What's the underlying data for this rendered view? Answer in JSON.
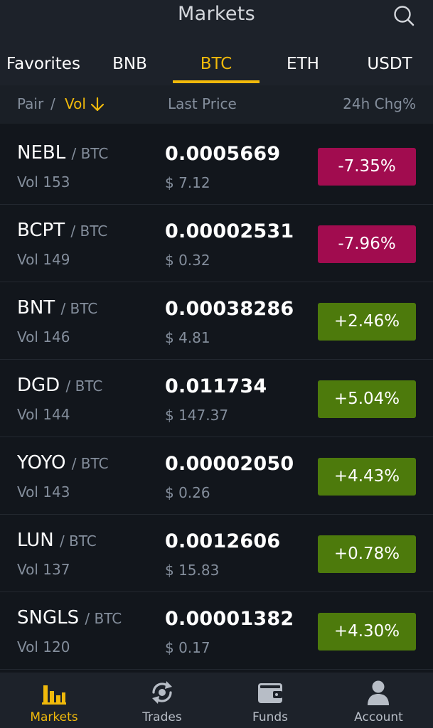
{
  "header": {
    "title": "Markets",
    "search_icon": "search-icon"
  },
  "tabs": [
    {
      "label": "Favorites",
      "active": false
    },
    {
      "label": "BNB",
      "active": false
    },
    {
      "label": "BTC",
      "active": true
    },
    {
      "label": "ETH",
      "active": false
    },
    {
      "label": "USDT",
      "active": false
    }
  ],
  "columns": {
    "pair": "Pair",
    "separator": "/",
    "vol": "Vol",
    "sort_icon": "arrow-down-icon",
    "last_price": "Last Price",
    "change": "24h Chg%"
  },
  "rows": [
    {
      "base": "NEBL",
      "quote": "/ BTC",
      "vol": "Vol 153",
      "price": "0.0005669",
      "usd": "$ 7.12",
      "change": "-7.35%",
      "direction": "down"
    },
    {
      "base": "BCPT",
      "quote": "/ BTC",
      "vol": "Vol 149",
      "price": "0.00002531",
      "usd": "$ 0.32",
      "change": "-7.96%",
      "direction": "down"
    },
    {
      "base": "BNT",
      "quote": "/ BTC",
      "vol": "Vol 146",
      "price": "0.00038286",
      "usd": "$ 4.81",
      "change": "+2.46%",
      "direction": "up"
    },
    {
      "base": "DGD",
      "quote": "/ BTC",
      "vol": "Vol 144",
      "price": "0.011734",
      "usd": "$ 147.37",
      "change": "+5.04%",
      "direction": "up"
    },
    {
      "base": "YOYO",
      "quote": "/ BTC",
      "vol": "Vol 143",
      "price": "0.00002050",
      "usd": "$ 0.26",
      "change": "+4.43%",
      "direction": "up"
    },
    {
      "base": "LUN",
      "quote": "/ BTC",
      "vol": "Vol 137",
      "price": "0.0012606",
      "usd": "$ 15.83",
      "change": "+0.78%",
      "direction": "up"
    },
    {
      "base": "SNGLS",
      "quote": "/ BTC",
      "vol": "Vol 120",
      "price": "0.00001382",
      "usd": "$ 0.17",
      "change": "+4.30%",
      "direction": "up"
    }
  ],
  "bottom_nav": [
    {
      "label": "Markets",
      "icon": "bar-chart-icon",
      "active": true
    },
    {
      "label": "Trades",
      "icon": "trades-refresh-icon",
      "active": false
    },
    {
      "label": "Funds",
      "icon": "wallet-icon",
      "active": false
    },
    {
      "label": "Account",
      "icon": "user-icon",
      "active": false
    }
  ],
  "colors": {
    "accent": "#f0b90b",
    "negative": "#a10c4f",
    "positive": "#4d7a0c",
    "background": "#12161c",
    "panel": "#1d222a",
    "muted_text": "#848e9c"
  }
}
